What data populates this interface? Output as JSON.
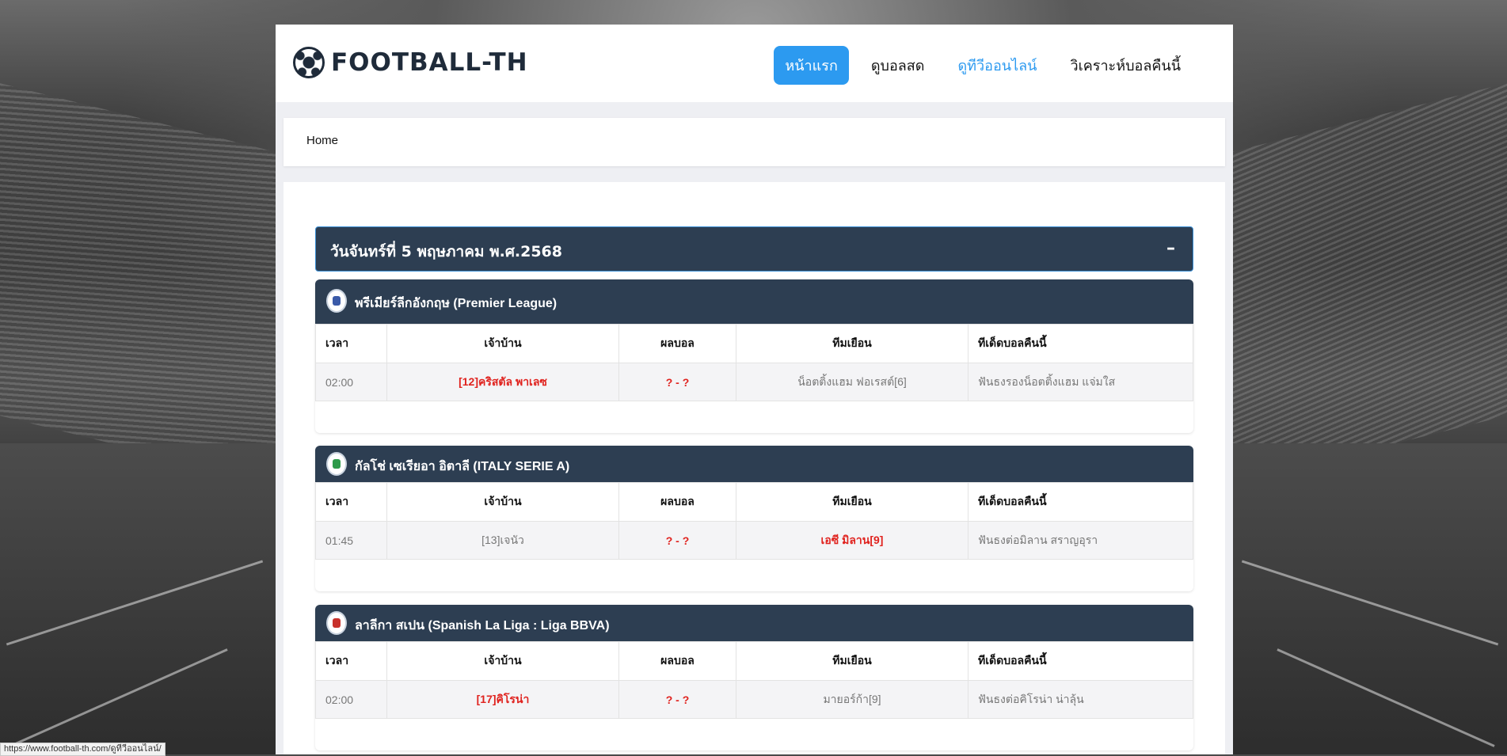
{
  "site": {
    "logo_text": "FOOTBALL-TH"
  },
  "nav": [
    {
      "label": "หน้าแรก",
      "state": "active"
    },
    {
      "label": "ดูบอลสด",
      "state": "normal"
    },
    {
      "label": "ดูทีวีออนไลน์",
      "state": "hover"
    },
    {
      "label": "วิเคราะห์บอลคืนนี้",
      "state": "normal"
    }
  ],
  "breadcrumb": {
    "home": "Home"
  },
  "date_bar": {
    "text": "วันจันทร์ที่ 5 พฤษภาคม พ.ศ.2568",
    "toggle": "–"
  },
  "table_headers": {
    "time": "เวลา",
    "home": "เจ้าบ้าน",
    "score": "ผลบอล",
    "away": "ทีมเยือน",
    "tip": "ทีเด็ดบอลคืนนี้"
  },
  "leagues": [
    {
      "title": "พรีเมียร์ลีกอังกฤษ (Premier League)",
      "icon": "premier-league-icon",
      "match": {
        "time": "02:00",
        "home": "[12]คริสตัล พาเลซ",
        "score": "? - ?",
        "away": "น็อตติ้งแฮม ฟอเรสต์[6]",
        "tip": "ฟันธงรองน็อตติ้งแฮม แจ่มใส",
        "favored": "home"
      }
    },
    {
      "title": "กัลโช่ เซเรียอา อิตาลี (ITALY SERIE A)",
      "icon": "serie-a-icon",
      "match": {
        "time": "01:45",
        "home": "[13]เจนัว",
        "score": "? - ?",
        "away": "เอซี มิลาน[9]",
        "tip": "ฟันธงต่อมิลาน สราญอุรา",
        "favored": "away"
      }
    },
    {
      "title": "ลาลีกา สเปน (Spanish La Liga : Liga BBVA)",
      "icon": "la-liga-icon",
      "match": {
        "time": "02:00",
        "home": "[17]คิโรน่า",
        "score": "? - ?",
        "away": "มายอร์ก้า[9]",
        "tip": "ฟันธงต่อคิโรน่า น่าลุ้น",
        "favored": "home"
      }
    }
  ],
  "status_bar": {
    "url": "https://www.football-th.com/ดูทีวีออนไลน์/"
  },
  "colors": {
    "accent": "#2c9af0",
    "header_dark": "#2d3e52",
    "highlight_red": "#e0231f"
  }
}
